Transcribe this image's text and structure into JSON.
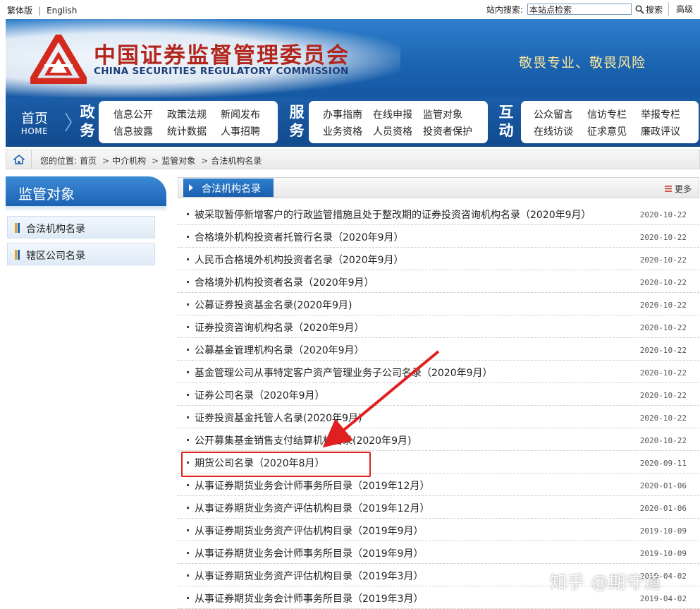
{
  "topbar": {
    "lang_traditional": "繁体版",
    "lang_separator": "|",
    "lang_english": "English",
    "search_label": "站内搜索:",
    "search_value": "本站点检索",
    "search_button": "搜索",
    "advanced": "高级"
  },
  "banner": {
    "cn_title": "中国证券监督管理委员会",
    "en_title": "CHINA SECURITIES REGULATORY COMMISSION",
    "slogan": "敬畏专业、敬畏风险",
    "logo_color": "#d42a1e"
  },
  "nav": {
    "home_cn": "首页",
    "home_en": "HOME",
    "groups": [
      {
        "cat_1": "政",
        "cat_2": "务",
        "row1": [
          "信息公开",
          "政策法规",
          "新闻发布"
        ],
        "row2": [
          "信息披露",
          "统计数据",
          "人事招聘"
        ]
      },
      {
        "cat_1": "服",
        "cat_2": "务",
        "row1": [
          "办事指南",
          "在线申报",
          "监管对象"
        ],
        "row2": [
          "业务资格",
          "人员资格",
          "投资者保护"
        ]
      },
      {
        "cat_1": "互",
        "cat_2": "动",
        "row1": [
          "公众留言",
          "信访专栏",
          "举报专栏"
        ],
        "row2": [
          "在线访谈",
          "征求意见",
          "廉政评议"
        ]
      }
    ]
  },
  "breadcrumb": {
    "prefix": "您的位置:",
    "items": [
      "首页",
      "中介机构",
      "监管对象",
      "合法机构名录"
    ],
    "separator": ">"
  },
  "sidebar": {
    "title": "监管对象",
    "items": [
      "合法机构名录",
      "辖区公司名录"
    ]
  },
  "list": {
    "title": "合法机构名录",
    "more": "更多",
    "rows": [
      {
        "title": "被采取暂停新增客户的行政监管措施且处于整改期的证券投资咨询机构名录（2020年9月）",
        "date": "2020-10-22"
      },
      {
        "title": "合格境外机构投资者托管行名录（2020年9月）",
        "date": "2020-10-22"
      },
      {
        "title": "人民币合格境外机构投资者名录（2020年9月）",
        "date": "2020-10-22"
      },
      {
        "title": "合格境外机构投资者名录（2020年9月）",
        "date": "2020-10-22"
      },
      {
        "title": "公募证券投资基金名录(2020年9月)",
        "date": "2020-10-22"
      },
      {
        "title": "证券投资咨询机构名录（2020年9月）",
        "date": "2020-10-22"
      },
      {
        "title": "公募基金管理机构名录（2020年9月）",
        "date": "2020-10-22"
      },
      {
        "title": "基金管理公司从事特定客户资产管理业务子公司名录（2020年9月）",
        "date": "2020-10-22"
      },
      {
        "title": "证券公司名录（2020年9月）",
        "date": "2020-10-22"
      },
      {
        "title": "证券投资基金托管人名录(2020年9月)",
        "date": "2020-10-22"
      },
      {
        "title": "公开募集基金销售支付结算机构名录(2020年9月)",
        "date": "2020-10-22"
      },
      {
        "title": "期货公司名录（2020年8月）",
        "date": "2020-09-11"
      },
      {
        "title": "从事证券期货业务会计师事务所目录（2019年12月）",
        "date": "2020-01-06"
      },
      {
        "title": "从事证券期货业务资产评估机构目录（2019年12月）",
        "date": "2020-01-06"
      },
      {
        "title": "从事证券期货业务资产评估机构目录（2019年9月）",
        "date": "2019-10-09"
      },
      {
        "title": "从事证券期货业务会计师事务所目录（2019年9月）",
        "date": "2019-10-09"
      },
      {
        "title": "从事证券期货业务资产评估机构目录（2019年3月）",
        "date": "2019-04-02"
      },
      {
        "title": "从事证券期货业务会计师事务所目录（2019年3月）",
        "date": "2019-04-02"
      }
    ]
  },
  "annotation": {
    "highlight_color": "#e02020",
    "watermark": "知乎 @期守道"
  }
}
